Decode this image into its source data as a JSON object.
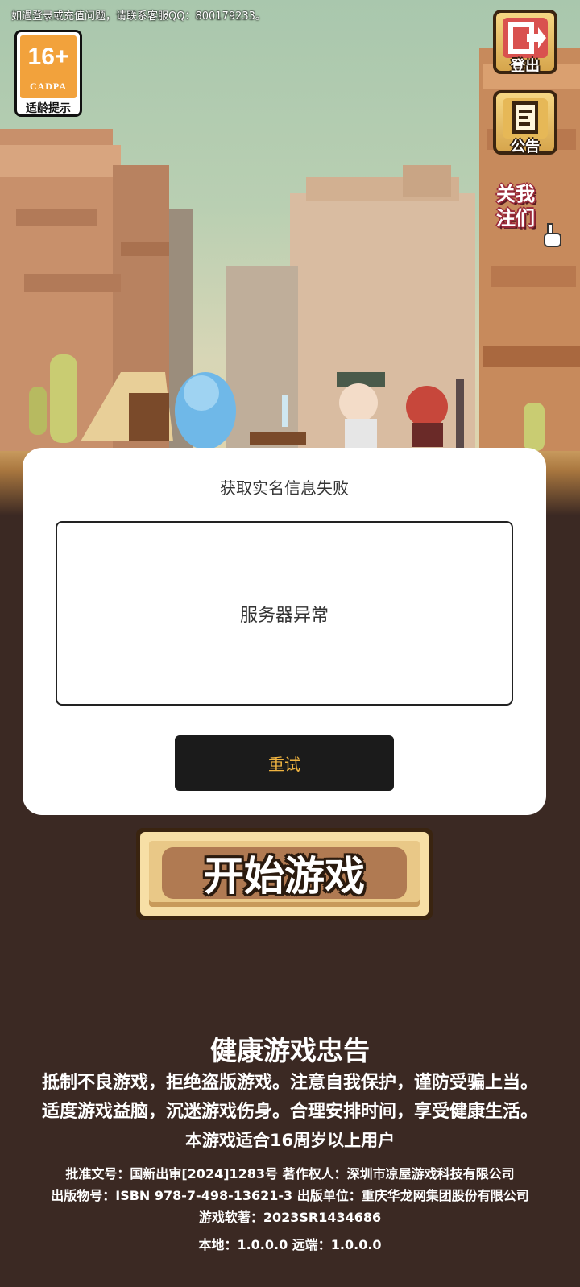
{
  "notice": "如遇登录或充值问题，请联系客服QQ：800179233。",
  "age_badge": {
    "number": "16+",
    "org": "CADPA",
    "label": "适龄提示"
  },
  "side_buttons": {
    "logout": "登出",
    "announcement": "公告",
    "follow": [
      "关我",
      "注们"
    ]
  },
  "dialog": {
    "title": "获取实名信息失败",
    "message": "服务器异常",
    "retry_label": "重试"
  },
  "start_button": "开始游戏",
  "health_advice": {
    "title": "健康游戏忠告",
    "line1": "抵制不良游戏，拒绝盗版游戏。注意自我保护，谨防受骗上当。",
    "line2": "适度游戏益脑，沉迷游戏伤身。合理安排时间，享受健康生活。",
    "line3": "本游戏适合16周岁以上用户"
  },
  "publication": {
    "line1": "批准文号：国新出审[2024]1283号   著作权人：深圳市凉屋游戏科技有限公司",
    "line2": "出版物号：ISBN 978-7-498-13621-3   出版单位：重庆华龙网集团股份有限公司",
    "line3": "游戏软著：2023SR1434686"
  },
  "version": "本地：1.0.0.0   远端：1.0.0.0",
  "colors": {
    "background": "#3b2923",
    "retry_text": "#f0b441",
    "age_badge": "#f2a23c"
  }
}
